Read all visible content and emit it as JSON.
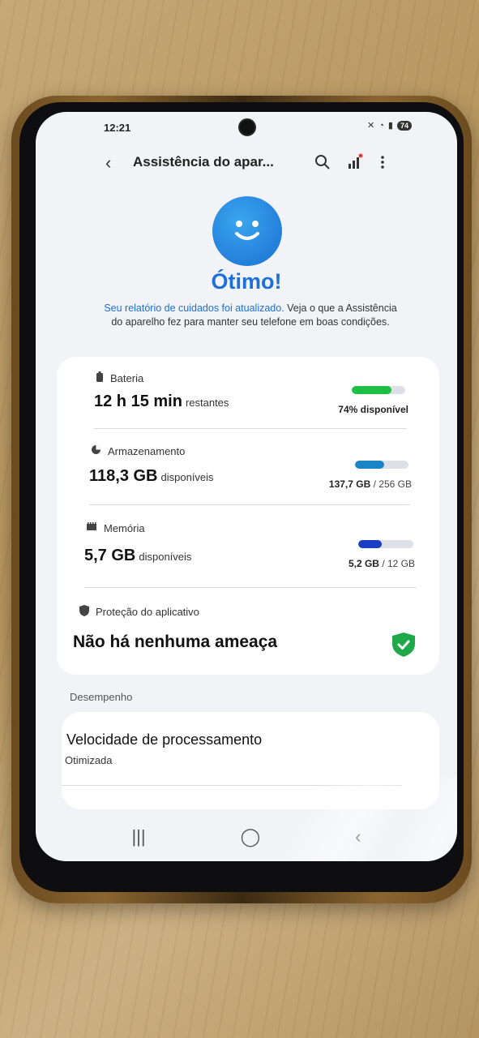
{
  "status_bar": {
    "time": "12:21",
    "battery_level": "74"
  },
  "header": {
    "title": "Assistência do apar...",
    "back_icon": "back-arrow-icon",
    "search_icon": "search-icon",
    "signal_icon": "signal-bars-icon",
    "more_icon": "more-vertical-icon"
  },
  "hero": {
    "title": "Ótimo!",
    "desc_link": "Seu relatório de cuidados foi atualizado.",
    "desc_rest": " Veja o que a Assistência do aparelho fez para manter seu telefone em boas condições."
  },
  "battery": {
    "label": "Bateria",
    "value": "12 h 15 min",
    "suffix": "restantes",
    "caption": "74% disponível",
    "fill_fraction": 0.74,
    "color": "#1fbf46"
  },
  "storage": {
    "label": "Armazenamento",
    "value": "118,3 GB",
    "suffix": "disponíveis",
    "used": "137,7 GB",
    "total": "/ 256 GB",
    "fill_fraction": 0.54,
    "color": "#1a86c8"
  },
  "memory": {
    "label": "Memória",
    "value": "5,7 GB",
    "suffix": "disponíveis",
    "used": "5,2 GB",
    "total": "/ 12 GB",
    "fill_fraction": 0.43,
    "color": "#1a3ec2"
  },
  "protection": {
    "label": "Proteção do aplicativo",
    "status": "Não há nenhuma ameaça",
    "color": "#1fa84a"
  },
  "performance": {
    "section_label": "Desempenho",
    "title": "Velocidade de processamento",
    "subtitle": "Otimizada"
  },
  "nav": {
    "recents": "|||",
    "home": "◯",
    "back": "‹"
  }
}
